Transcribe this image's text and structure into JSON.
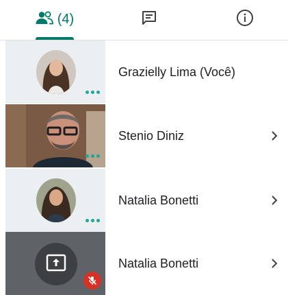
{
  "tabs": {
    "people": {
      "icon": "people-icon",
      "count_label": "(4)",
      "active": true
    },
    "chat": {
      "icon": "chat-icon"
    },
    "info": {
      "icon": "info-icon"
    }
  },
  "colors": {
    "accent": "#00796b",
    "speaking_dots": "#1ea89a",
    "muted_badge": "#d93025",
    "text": "#202124"
  },
  "participants": [
    {
      "name": "Grazielly Lima (Você)",
      "tile": "avatar-photo",
      "status_icon": "more-dots-icon",
      "has_chevron": false
    },
    {
      "name": "Stenio Diniz",
      "tile": "video-feed",
      "status_icon": "more-dots-icon",
      "has_chevron": true
    },
    {
      "name": "Natalia Bonetti",
      "tile": "avatar-photo",
      "status_icon": "more-dots-icon",
      "has_chevron": true
    },
    {
      "name": "Natalia Bonetti",
      "tile": "presentation",
      "status_icon": "mic-off-icon",
      "has_chevron": true
    }
  ]
}
